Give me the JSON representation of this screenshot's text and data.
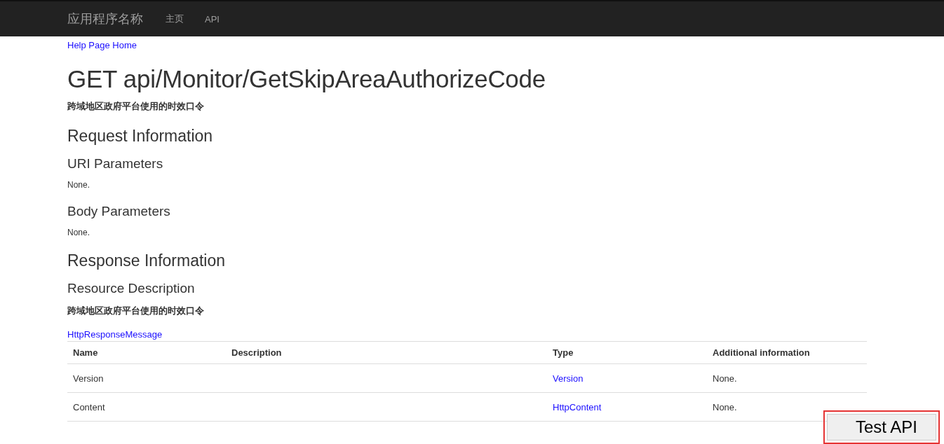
{
  "navbar": {
    "brand": "应用程序名称",
    "links": [
      "主页",
      "API"
    ]
  },
  "breadcrumb": "Help Page Home",
  "title": "GET api/Monitor/GetSkipAreaAuthorizeCode",
  "description": "跨域地区政府平台使用的时效口令",
  "sections": [
    {
      "kind": "heading",
      "text": "Request Information"
    },
    {
      "kind": "subheading",
      "text": "URI Parameters"
    },
    {
      "kind": "text",
      "text": "None."
    },
    {
      "kind": "subheading",
      "text": "Body Parameters"
    },
    {
      "kind": "text",
      "text": "None."
    },
    {
      "kind": "heading",
      "text": "Response Information"
    },
    {
      "kind": "subheading",
      "text": "Resource Description"
    },
    {
      "kind": "strong",
      "text": "跨域地区政府平台使用的时效口令"
    },
    {
      "kind": "link",
      "text": "HttpResponseMessage"
    }
  ],
  "table": {
    "columns": [
      "Name",
      "Description",
      "Type",
      "Additional information"
    ],
    "rows": [
      {
        "name": "Version",
        "type": "Version",
        "additional": "None."
      },
      {
        "name": "Content",
        "type": "HttpContent",
        "additional": "None."
      }
    ]
  },
  "test_button": {
    "label": "Test API",
    "highlighted": true
  }
}
